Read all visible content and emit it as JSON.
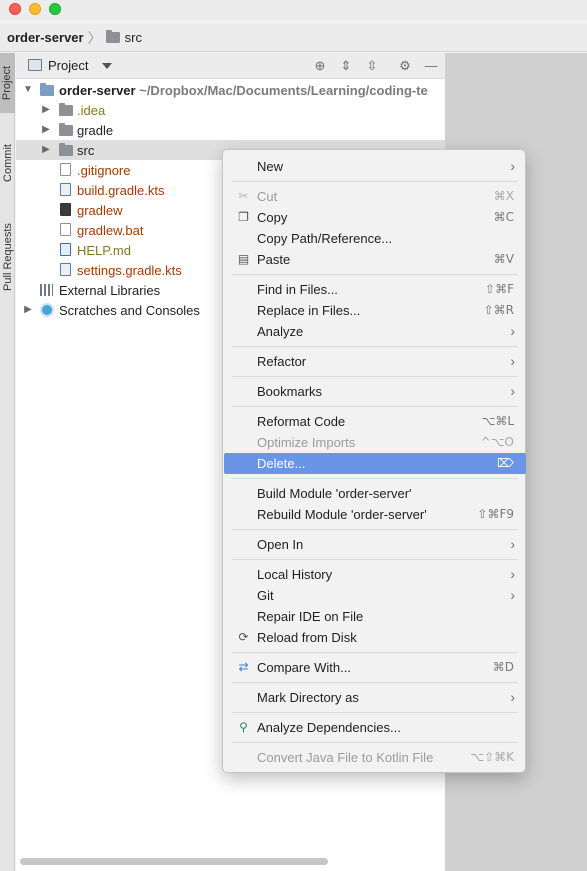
{
  "breadcrumb": {
    "root": "order-server",
    "leaf": "src"
  },
  "toolwindows": {
    "project": "Project",
    "commit": "Commit",
    "pull_requests": "Pull Requests"
  },
  "panel": {
    "title": "Project"
  },
  "tree": {
    "root": {
      "label": "order-server",
      "path": " ~/Dropbox/Mac/Documents/Learning/coding-te"
    },
    "items": [
      {
        "label": ".idea"
      },
      {
        "label": "gradle"
      },
      {
        "label": "src"
      },
      {
        "label": ".gitignore"
      },
      {
        "label": "build.gradle.kts"
      },
      {
        "label": "gradlew"
      },
      {
        "label": "gradlew.bat"
      },
      {
        "label": "HELP.md"
      },
      {
        "label": "settings.gradle.kts"
      },
      {
        "label": "External Libraries"
      },
      {
        "label": "Scratches and Consoles"
      }
    ]
  },
  "menu": {
    "items": [
      {
        "label": "New",
        "shortcut": "",
        "submenu": true
      },
      {
        "label": "Cut",
        "shortcut": "⌘X",
        "disabled": true
      },
      {
        "label": "Copy",
        "shortcut": "⌘C"
      },
      {
        "label": "Copy Path/Reference...",
        "shortcut": ""
      },
      {
        "label": "Paste",
        "shortcut": "⌘V"
      },
      {
        "label": "Find in Files...",
        "shortcut": "⇧⌘F"
      },
      {
        "label": "Replace in Files...",
        "shortcut": "⇧⌘R"
      },
      {
        "label": "Analyze",
        "submenu": true
      },
      {
        "label": "Refactor",
        "submenu": true
      },
      {
        "label": "Bookmarks",
        "submenu": true
      },
      {
        "label": "Reformat Code",
        "shortcut": "⌥⌘L"
      },
      {
        "label": "Optimize Imports",
        "shortcut": "^⌥O",
        "disabled": true
      },
      {
        "label": "Delete...",
        "shortcut": "⌦",
        "highlighted": true
      },
      {
        "label": "Build Module 'order-server'",
        "shortcut": ""
      },
      {
        "label": "Rebuild Module 'order-server'",
        "shortcut": "⇧⌘F9"
      },
      {
        "label": "Open In",
        "submenu": true
      },
      {
        "label": "Local History",
        "submenu": true
      },
      {
        "label": "Git",
        "submenu": true
      },
      {
        "label": "Repair IDE on File",
        "shortcut": ""
      },
      {
        "label": "Reload from Disk",
        "shortcut": ""
      },
      {
        "label": "Compare With...",
        "shortcut": "⌘D"
      },
      {
        "label": "Mark Directory as",
        "submenu": true
      },
      {
        "label": "Analyze Dependencies...",
        "shortcut": ""
      },
      {
        "label": "Convert Java File to Kotlin File",
        "shortcut": "⌥⇧⌘K",
        "disabled": true
      }
    ]
  },
  "colors": {
    "highlight": "#6a95e6",
    "modified_file": "#a33b00",
    "ignored_file": "#7d7a22"
  }
}
